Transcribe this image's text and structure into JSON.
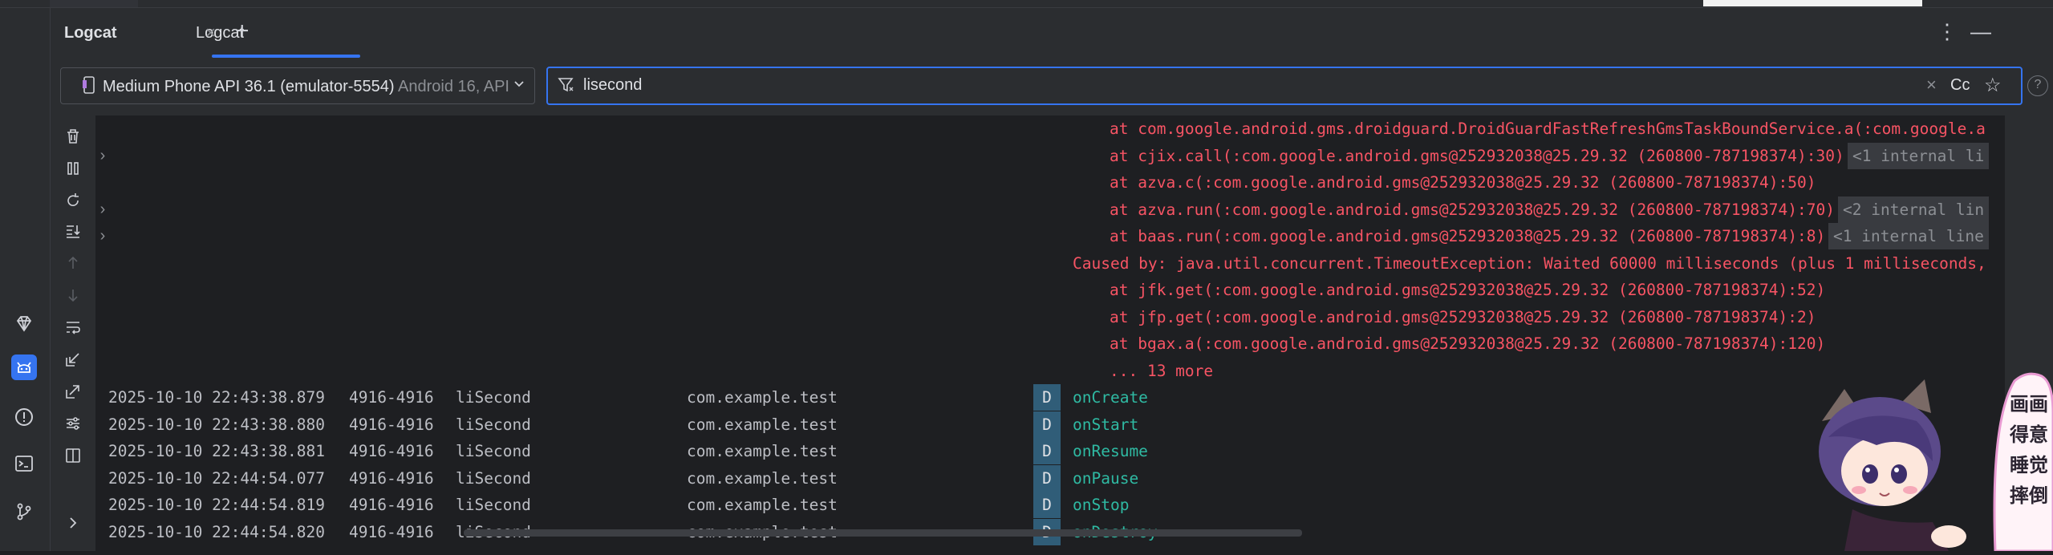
{
  "header": {
    "title": "Logcat",
    "tab_label": "Logcat",
    "tab_close": "×",
    "add_tab": "+",
    "more": "⋮",
    "minimize": "—"
  },
  "toolbar": {
    "device_name": "Medium Phone API 36.1 (emulator-5554)",
    "device_sub": " Android 16, API",
    "filter_value": "lisecond",
    "clear": "×",
    "match_case": "Cc",
    "favorite": "☆",
    "help": "?"
  },
  "leftbar_icons": [
    "gem-icon",
    "android-cat-icon",
    "problems-icon",
    "terminal-icon",
    "git-icon"
  ],
  "log": {
    "stack_rows": [
      {
        "text": "at com.google.android.gms.droidguard.DroidGuardFastRefreshGmsTaskBoundService.a(:com.google.a",
        "internal": "",
        "expander": false
      },
      {
        "text": "at cjix.call(:com.google.android.gms@252932038@25.29.32 (260800-787198374):30)",
        "internal": "<1 internal li",
        "expander": true
      },
      {
        "text": "at azva.c(:com.google.android.gms@252932038@25.29.32 (260800-787198374):50)",
        "internal": "",
        "expander": false
      },
      {
        "text": "at azva.run(:com.google.android.gms@252932038@25.29.32 (260800-787198374):70)",
        "internal": "<2 internal lin",
        "expander": true
      },
      {
        "text": "at baas.run(:com.google.android.gms@252932038@25.29.32 (260800-787198374):8)",
        "internal": "<1 internal line",
        "expander": true
      },
      {
        "text": "Caused by: java.util.concurrent.TimeoutException: Waited 60000 milliseconds (plus 1 milliseconds,",
        "internal": "",
        "expander": false,
        "caused": true
      },
      {
        "text": "at jfk.get(:com.google.android.gms@252932038@25.29.32 (260800-787198374):52)",
        "internal": "",
        "expander": false
      },
      {
        "text": "at jfp.get(:com.google.android.gms@252932038@25.29.32 (260800-787198374):2)",
        "internal": "",
        "expander": false
      },
      {
        "text": "at bgax.a(:com.google.android.gms@252932038@25.29.32 (260800-787198374):120)",
        "internal": "",
        "expander": false
      },
      {
        "text": "... 13 more",
        "internal": "",
        "expander": false
      }
    ],
    "entries": [
      {
        "ts": "2025-10-10 22:43:38.879",
        "pid": "4916-4916",
        "tag": "liSecond",
        "pkg": "com.example.test",
        "level": "D",
        "msg": "onCreate"
      },
      {
        "ts": "2025-10-10 22:43:38.880",
        "pid": "4916-4916",
        "tag": "liSecond",
        "pkg": "com.example.test",
        "level": "D",
        "msg": "onStart"
      },
      {
        "ts": "2025-10-10 22:43:38.881",
        "pid": "4916-4916",
        "tag": "liSecond",
        "pkg": "com.example.test",
        "level": "D",
        "msg": "onResume"
      },
      {
        "ts": "2025-10-10 22:44:54.077",
        "pid": "4916-4916",
        "tag": "liSecond",
        "pkg": "com.example.test",
        "level": "D",
        "msg": "onPause"
      },
      {
        "ts": "2025-10-10 22:44:54.819",
        "pid": "4916-4916",
        "tag": "liSecond",
        "pkg": "com.example.test",
        "level": "D",
        "msg": "onStop"
      },
      {
        "ts": "2025-10-10 22:44:54.820",
        "pid": "4916-4916",
        "tag": "liSecond",
        "pkg": "com.example.test",
        "level": "D",
        "msg": "onDestroy"
      }
    ]
  },
  "mascot": {
    "captions": [
      "画画",
      "得意",
      "睡觉",
      "摔倒"
    ]
  },
  "colors": {
    "accent": "#3574f0",
    "error": "#f75464",
    "debug_msg": "#2fbaa3",
    "debug_badge": "#305d78"
  }
}
